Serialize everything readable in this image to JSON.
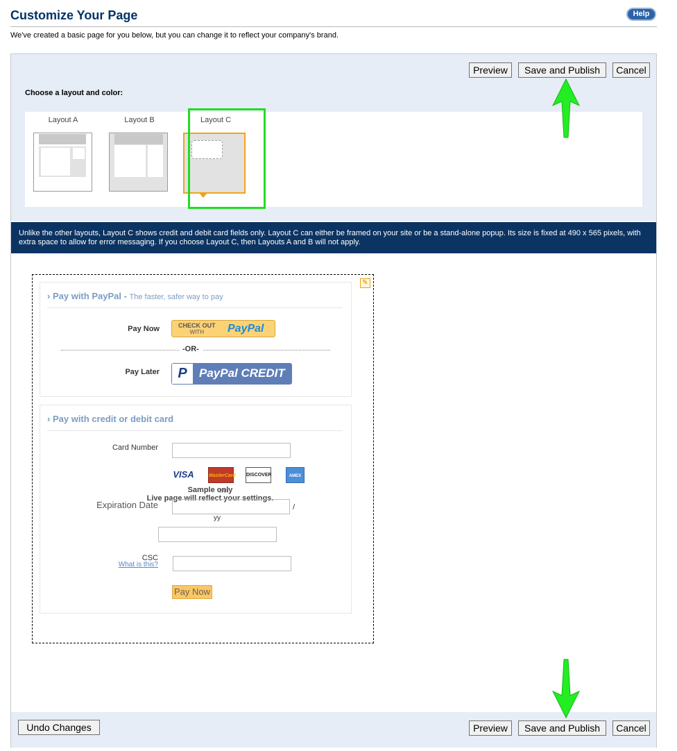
{
  "header": {
    "title": "Customize Your Page",
    "help_label": "Help",
    "intro": "We've created a basic page for you below, but you can change it to reflect your company's brand."
  },
  "toolbar": {
    "preview_label": "Preview",
    "save_publish_label": "Save and Publish",
    "cancel_label": "Cancel"
  },
  "layout_section": {
    "label": "Choose a layout and color:",
    "options": [
      {
        "name": "Layout A"
      },
      {
        "name": "Layout B"
      },
      {
        "name": "Layout C",
        "selected": true
      }
    ]
  },
  "info_text": "Unlike the other layouts, Layout C shows credit and debit card fields only. Layout C can either be framed on your site or be a stand-alone popup. Its size is fixed at 490 x 565 pixels, with extra space to allow for error messaging. If you choose Layout C, then Layouts A and B will not apply.",
  "preview": {
    "edit_icon": "pencil-icon",
    "paypal_section": {
      "title": "Pay with PayPal -",
      "subtitle": "The faster, safer way to pay",
      "pay_now_label": "Pay Now",
      "checkout_top": "CHECK OUT",
      "checkout_with": "WITH",
      "checkout_logo": "PayPal",
      "or_text": "-OR-",
      "pay_later_label": "Pay Later",
      "credit_logo_letter": "P",
      "credit_text": "PayPal CREDIT"
    },
    "card_section": {
      "title": "Pay with credit or debit card",
      "card_number_label": "Card Number",
      "card_logos": [
        "VISA",
        "MasterCard",
        "DISCOVER",
        "AMEX"
      ],
      "sample_only": "Sample only",
      "mm": "mm",
      "live_note": "Live page will reflect your settings.",
      "expiration_label": "Expiration Date",
      "slash": "/",
      "yy": "yy",
      "csc_label": "CSC",
      "what_is_this": "What is this?",
      "pay_now_button": "Pay Now"
    }
  },
  "footer": {
    "undo_label": "Undo Changes"
  },
  "colors": {
    "title": "#003366",
    "band": "#e6edf6",
    "info_band": "#0c3462",
    "section_title": "#7b9cc4",
    "highlight": "#22dd22"
  }
}
